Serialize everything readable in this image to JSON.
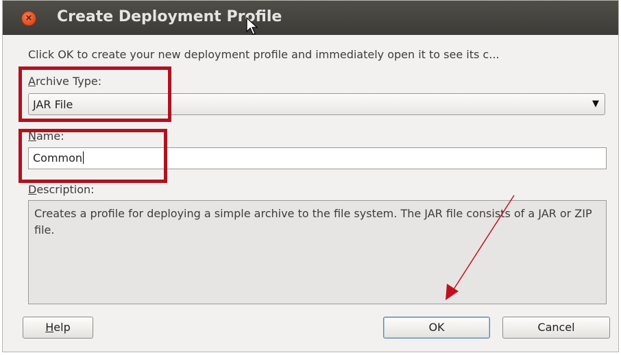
{
  "dialog": {
    "title": "Create Deployment Profile",
    "intro": "Click OK to create your new deployment profile and immediately open it to see its c...",
    "archive_type": {
      "mnemonic": "A",
      "label_rest": "rchive Type:",
      "value": "JAR File"
    },
    "name": {
      "mnemonic": "N",
      "label_rest": "ame:",
      "value": "Common"
    },
    "description": {
      "mnemonic": "D",
      "label_rest": "escription:",
      "text": "Creates a profile for deploying a simple archive to the file system. The JAR file consists of a JAR or ZIP file."
    },
    "buttons": {
      "help_mnemonic": "H",
      "help_rest": "elp",
      "ok": "OK",
      "cancel": "Cancel"
    }
  },
  "icons": {
    "close": "×",
    "dropdown_arrow": "▼"
  },
  "colors": {
    "titlebar": "#3c3b37",
    "close_button": "#df4a1a",
    "highlight": "#b0121f",
    "arrow": "#c01020"
  }
}
